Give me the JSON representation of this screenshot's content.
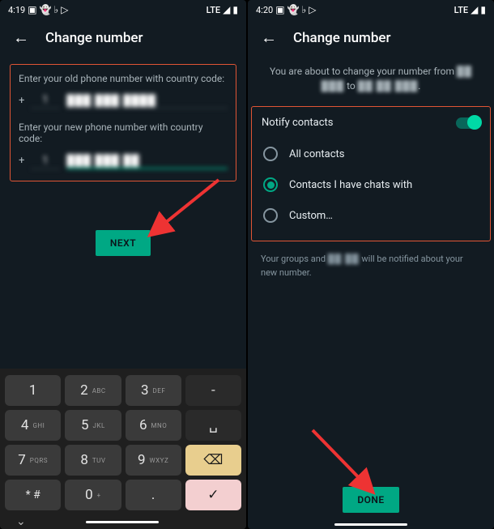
{
  "left": {
    "status": {
      "time": "4:19",
      "network": "LTE"
    },
    "header": {
      "title": "Change number"
    },
    "old_label": "Enter your old phone number with country code:",
    "new_label": "Enter your new phone number with country code:",
    "old_cc": "1",
    "old_num": "███ ███ ████",
    "new_cc": "1",
    "new_num": "███ ███ ██",
    "next": "NEXT",
    "keys": {
      "1": "1",
      "2": "2",
      "2s": "ABC",
      "3": "3",
      "3s": "DEF",
      "4": "4",
      "4s": "GHI",
      "5": "5",
      "5s": "JKL",
      "6": "6",
      "6s": "MNO",
      "7": "7",
      "7s": "PQRS",
      "8": "8",
      "8s": "TUV",
      "9": "9",
      "9s": "WXYZ",
      "star": "* #",
      "0": "0",
      "0s": "+",
      "dot": "."
    }
  },
  "right": {
    "status": {
      "time": "4:20",
      "network": "LTE"
    },
    "header": {
      "title": "Change number"
    },
    "about_pre": "You are about to change your number from",
    "about_mid": "to",
    "from_num": "██ ███",
    "to_num": "██ ██ ███",
    "notify_label": "Notify contacts",
    "opt_all": "All contacts",
    "opt_chats": "Contacts I have chats with",
    "opt_custom": "Custom…",
    "groups_pre": "Your groups and",
    "groups_num": "██ ██",
    "groups_post": "will be notified about your new number.",
    "done": "DONE"
  }
}
